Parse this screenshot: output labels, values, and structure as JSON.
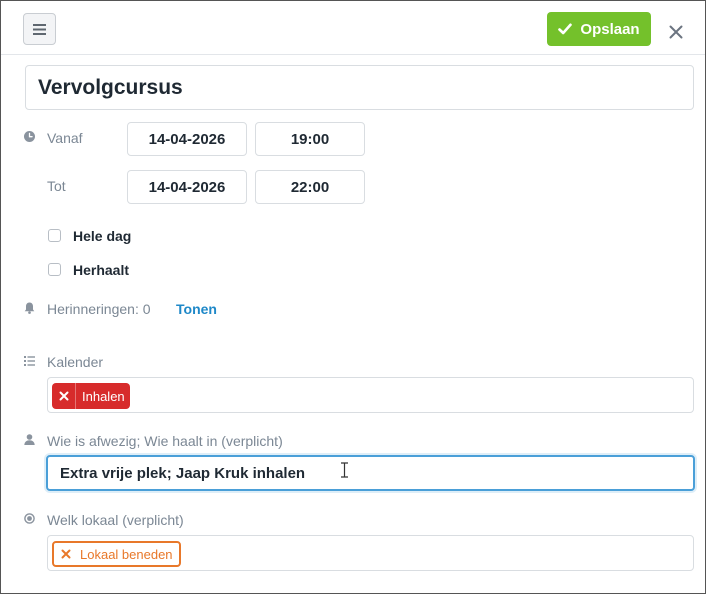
{
  "header": {
    "save_label": "Opslaan",
    "accent_color": "#74c12b",
    "icons": {
      "menu": "hamburger-icon",
      "save": "check-icon",
      "close": "close-icon"
    }
  },
  "event": {
    "title": "Vervolgcursus"
  },
  "time": {
    "from_label": "Vanaf",
    "from_date": "14-04-2026",
    "from_time": "19:00",
    "to_label": "Tot",
    "to_date": "14-04-2026",
    "to_time": "22:00",
    "icon": "clock-icon"
  },
  "options": {
    "all_day_label": "Hele dag",
    "all_day_checked": false,
    "repeats_label": "Herhaalt",
    "repeats_checked": false
  },
  "reminders": {
    "label": "Herinneringen: 0",
    "show_link": "Tonen",
    "icon": "bell-icon"
  },
  "calendar": {
    "label": "Kalender",
    "icon": "list-icon",
    "tags": [
      {
        "text": "Inhalen",
        "color": "#d72b2b"
      }
    ]
  },
  "absence": {
    "label": "Wie is afwezig; Wie haalt in (verplicht)",
    "value": "Extra vrije plek; Jaap Kruk inhalen",
    "icon": "user-icon"
  },
  "room": {
    "label": "Welk lokaal (verplicht)",
    "icon": "radio-icon",
    "tags": [
      {
        "text": "Lokaal beneden",
        "color": "#e8782a"
      }
    ]
  }
}
